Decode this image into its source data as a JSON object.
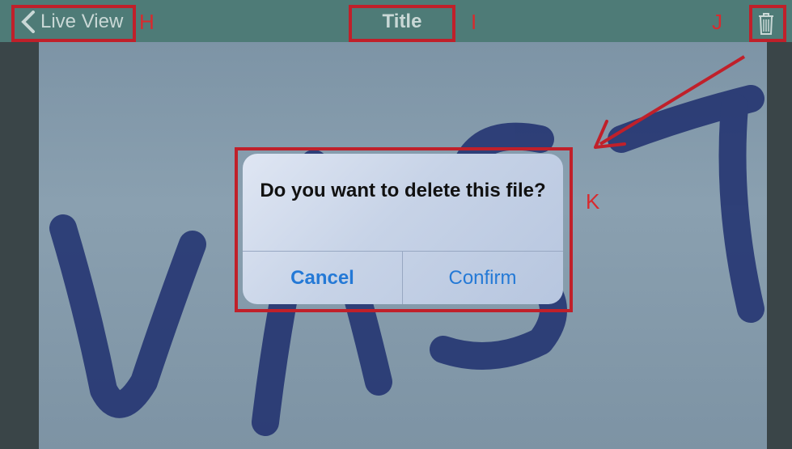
{
  "navbar": {
    "back_label": "Live View",
    "title": "Title"
  },
  "annotations": {
    "h": "H",
    "i": "I",
    "j": "J",
    "k": "K"
  },
  "dialog": {
    "message": "Do you want to delete this file?",
    "cancel_label": "Cancel",
    "confirm_label": "Confirm"
  },
  "colors": {
    "navbar": "#4e7b77",
    "annotation_red": "#c0202a",
    "button_blue": "#2479d6"
  },
  "icons": {
    "back": "chevron-left-icon",
    "trash": "trash-icon"
  }
}
